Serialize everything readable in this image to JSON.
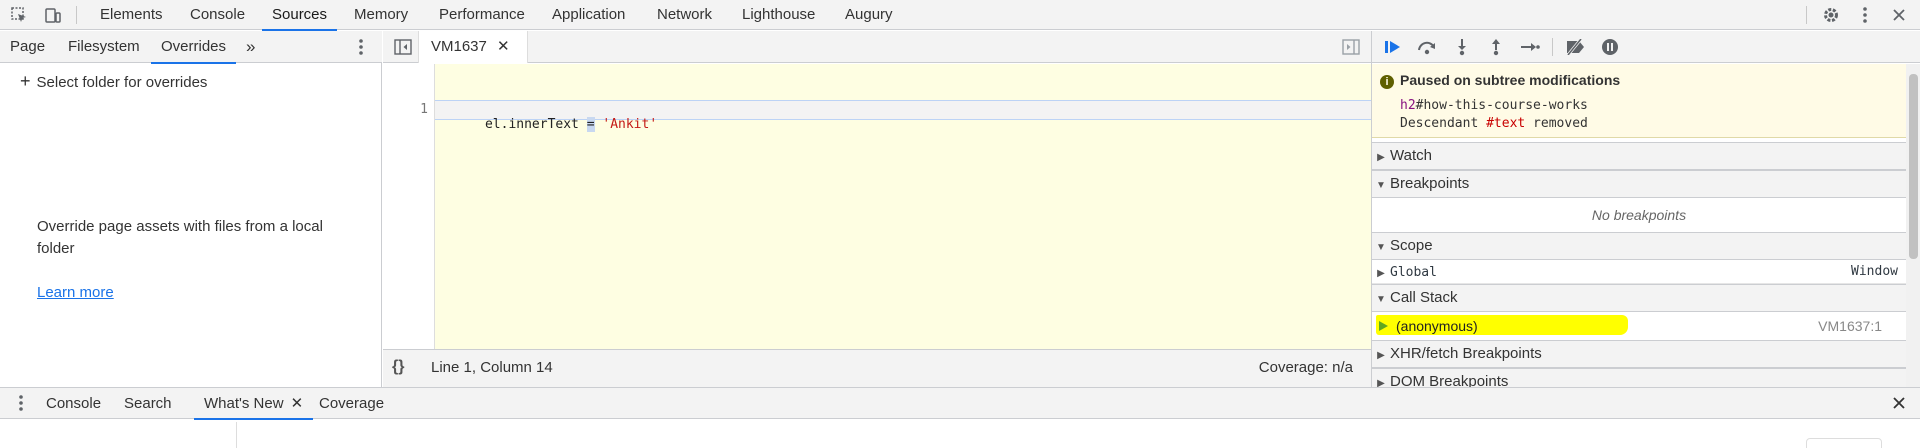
{
  "main_tabs": [
    "Elements",
    "Console",
    "Sources",
    "Memory",
    "Performance",
    "Application",
    "Network",
    "Lighthouse",
    "Augury"
  ],
  "active_main_tab": "Sources",
  "left_panel": {
    "tabs": [
      "Page",
      "Filesystem",
      "Overrides"
    ],
    "active_tab": "Overrides",
    "more_tabs_icon": "»",
    "select_folder_label": "Select folder for overrides",
    "empty_text": "Override page assets with files from a local folder",
    "learn_more": "Learn more"
  },
  "editor": {
    "tab_label": "VM1637",
    "line_number": "1",
    "code": {
      "lhs": "el.innerText ",
      "op": "=",
      "rhs": " 'Ankit'"
    },
    "status_position": "Line 1, Column 14",
    "coverage": "Coverage: n/a",
    "format_icon": "{}"
  },
  "debugger": {
    "paused_title": "Paused on subtree modifications",
    "paused_tag": "h2",
    "paused_selector": "#how-this-course-works",
    "paused_desc_a": "Descendant ",
    "paused_desc_b": "#text",
    "paused_desc_c": " removed",
    "watch": "Watch",
    "breakpoints": "Breakpoints",
    "no_breakpoints": "No breakpoints",
    "scope": "Scope",
    "global_label": "Global",
    "global_value": "Window",
    "call_stack": "Call Stack",
    "frame_name": "(anonymous)",
    "frame_location": "VM1637:1",
    "xhr": "XHR/fetch Breakpoints",
    "dom": "DOM Breakpoints"
  },
  "drawer_tabs": [
    "Console",
    "Search",
    "What's New",
    "Coverage"
  ],
  "active_drawer_tab": "What's New",
  "colors": {
    "accent": "#1a73e8",
    "highlight": "#ffff00",
    "editor_bg": "#fefee2",
    "paused_bg": "#fffbe6"
  }
}
